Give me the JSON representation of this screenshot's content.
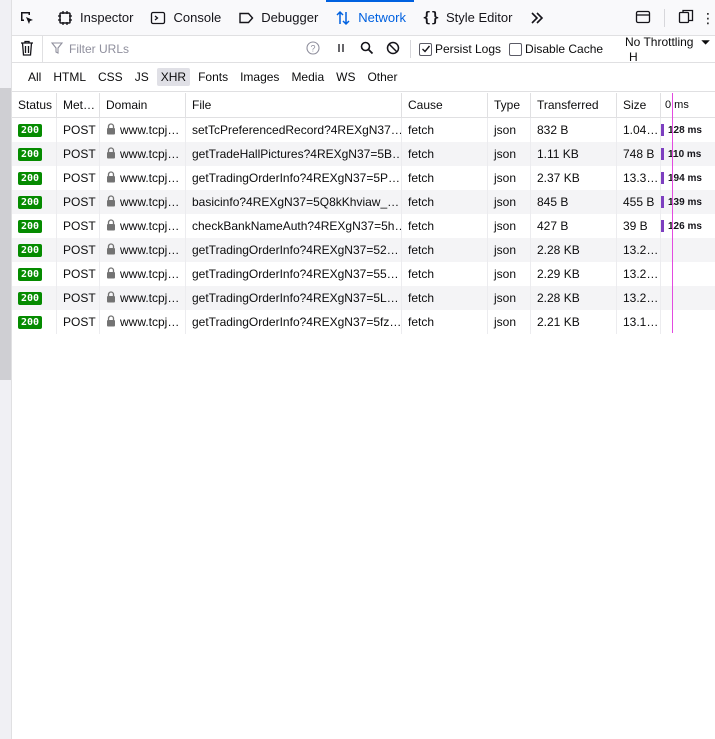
{
  "toolbox": {
    "tabs": [
      {
        "label": "Inspector",
        "icon": "inspector-icon"
      },
      {
        "label": "Console",
        "icon": "console-icon"
      },
      {
        "label": "Debugger",
        "icon": "debugger-icon"
      },
      {
        "label": "Network",
        "icon": "network-icon",
        "selected": true
      },
      {
        "label": "Style Editor",
        "icon": "style-editor-icon"
      }
    ],
    "more_icon": "chevron-double-right-icon"
  },
  "toolbar": {
    "filter_placeholder": "Filter URLs",
    "persist_logs_label": "Persist Logs",
    "persist_logs_checked": true,
    "disable_cache_label": "Disable Cache",
    "disable_cache_checked": false,
    "throttling_label": "No Throttling",
    "overflow_label": "H"
  },
  "type_filters": [
    "All",
    "HTML",
    "CSS",
    "JS",
    "XHR",
    "Fonts",
    "Images",
    "Media",
    "WS",
    "Other"
  ],
  "active_type_filter": "XHR",
  "columns": {
    "status": "Status",
    "method": "Met…",
    "domain": "Domain",
    "file": "File",
    "cause": "Cause",
    "type": "Type",
    "transferred": "Transferred",
    "size": "Size",
    "waterfall": "0 ms"
  },
  "requests": [
    {
      "status": "200",
      "method": "POST",
      "domain": "www.tcpj…",
      "file": "setTcPreferencedRecord?4REXgN37…",
      "cause": "fetch",
      "type": "json",
      "transferred": "832 B",
      "size": "1.04…",
      "time": "128 ms"
    },
    {
      "status": "200",
      "method": "POST",
      "domain": "www.tcpj…",
      "file": "getTradeHallPictures?4REXgN37=5B…",
      "cause": "fetch",
      "type": "json",
      "transferred": "1.11 KB",
      "size": "748 B",
      "time": "110 ms"
    },
    {
      "status": "200",
      "method": "POST",
      "domain": "www.tcpj…",
      "file": "getTradingOrderInfo?4REXgN37=5P…",
      "cause": "fetch",
      "type": "json",
      "transferred": "2.37 KB",
      "size": "13.3…",
      "time": "194 ms"
    },
    {
      "status": "200",
      "method": "POST",
      "domain": "www.tcpj…",
      "file": "basicinfo?4REXgN37=5Q8kKhviaw_…",
      "cause": "fetch",
      "type": "json",
      "transferred": "845 B",
      "size": "455 B",
      "time": "139 ms"
    },
    {
      "status": "200",
      "method": "POST",
      "domain": "www.tcpj…",
      "file": "checkBankNameAuth?4REXgN37=5h…",
      "cause": "fetch",
      "type": "json",
      "transferred": "427 B",
      "size": "39 B",
      "time": "126 ms"
    },
    {
      "status": "200",
      "method": "POST",
      "domain": "www.tcpj…",
      "file": "getTradingOrderInfo?4REXgN37=52…",
      "cause": "fetch",
      "type": "json",
      "transferred": "2.28 KB",
      "size": "13.2…",
      "time": ""
    },
    {
      "status": "200",
      "method": "POST",
      "domain": "www.tcpj…",
      "file": "getTradingOrderInfo?4REXgN37=55…",
      "cause": "fetch",
      "type": "json",
      "transferred": "2.29 KB",
      "size": "13.2…",
      "time": ""
    },
    {
      "status": "200",
      "method": "POST",
      "domain": "www.tcpj…",
      "file": "getTradingOrderInfo?4REXgN37=5L…",
      "cause": "fetch",
      "type": "json",
      "transferred": "2.28 KB",
      "size": "13.2…",
      "time": ""
    },
    {
      "status": "200",
      "method": "POST",
      "domain": "www.tcpj…",
      "file": "getTradingOrderInfo?4REXgN37=5fz…",
      "cause": "fetch",
      "type": "json",
      "transferred": "2.21 KB",
      "size": "13.1…",
      "time": ""
    }
  ],
  "colors": {
    "accent": "#0061e0",
    "status_ok": "#058b00",
    "timeline_marker": "#e24ae0"
  }
}
